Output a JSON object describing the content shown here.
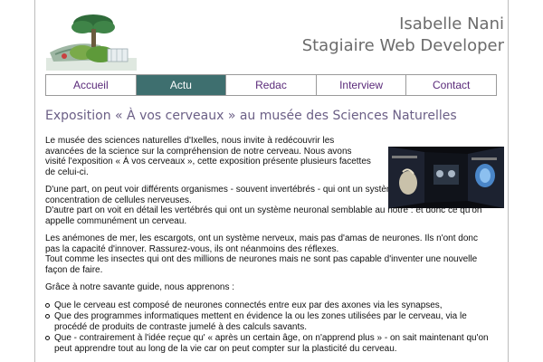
{
  "header": {
    "name": "Isabelle Nani",
    "role": "Stagiaire Web Developer"
  },
  "nav": {
    "items": [
      {
        "label": "Accueil",
        "active": false
      },
      {
        "label": "Actu",
        "active": true
      },
      {
        "label": "Redac",
        "active": false
      },
      {
        "label": "Interview",
        "active": false
      },
      {
        "label": "Contact",
        "active": false
      }
    ]
  },
  "article": {
    "title": "Exposition « À vos cerveaux » au musée des Sciences Naturelles",
    "p1": "Le musée des sciences naturelles d'Ixelles, nous invite à redécouvrir les avancées de la science sur la compréhension de notre cerveau. Nous avons visité l'exposition « À vos cerveaux », cette exposition présente plusieurs facettes de celui-ci.",
    "p2": "D'une part, on peut voir différents organismes - souvent invertébrés - qui ont un système nerveux mais pas de concentration de cellules nerveuses.",
    "p3": "D'autre part on voit en détail les vertébrés qui ont un système neuronal semblable au nôtre : et donc ce qu'on appelle communément un cerveau.",
    "p4": "Les anémones de mer, les escargots, ont un système nerveux, mais pas d'amas de neurones. Ils n'ont donc pas la capacité d'innover. Rassurez-vous, ils ont néanmoins des réflexes.",
    "p5": "Tout comme les insectes qui ont des millions de neurones mais ne sont pas capable d'inventer une nouvelle façon de faire.",
    "intro": "Grâce à notre savante guide, nous apprenons :",
    "bullets": [
      "Que le cerveau est composé de neurones connectés entre eux par des axones via les synapses,",
      "Que des programmes informatiques mettent en évidence la ou les zones utilisées par le cerveau, via le procédé de produits de contraste jumelé à des calculs savants.",
      "Que - contrairement à l'idée reçue qu' « après un certain âge, on n'apprend plus » - on sait maintenant qu'on peut apprendre tout au long de la vie car on peut compter sur la plasticité du cerveau."
    ]
  },
  "colors": {
    "nav_active": "#3e6f6f",
    "nav_text": "#5a2a7a",
    "title": "#6b5f86",
    "header_text": "#6b6b6b"
  }
}
